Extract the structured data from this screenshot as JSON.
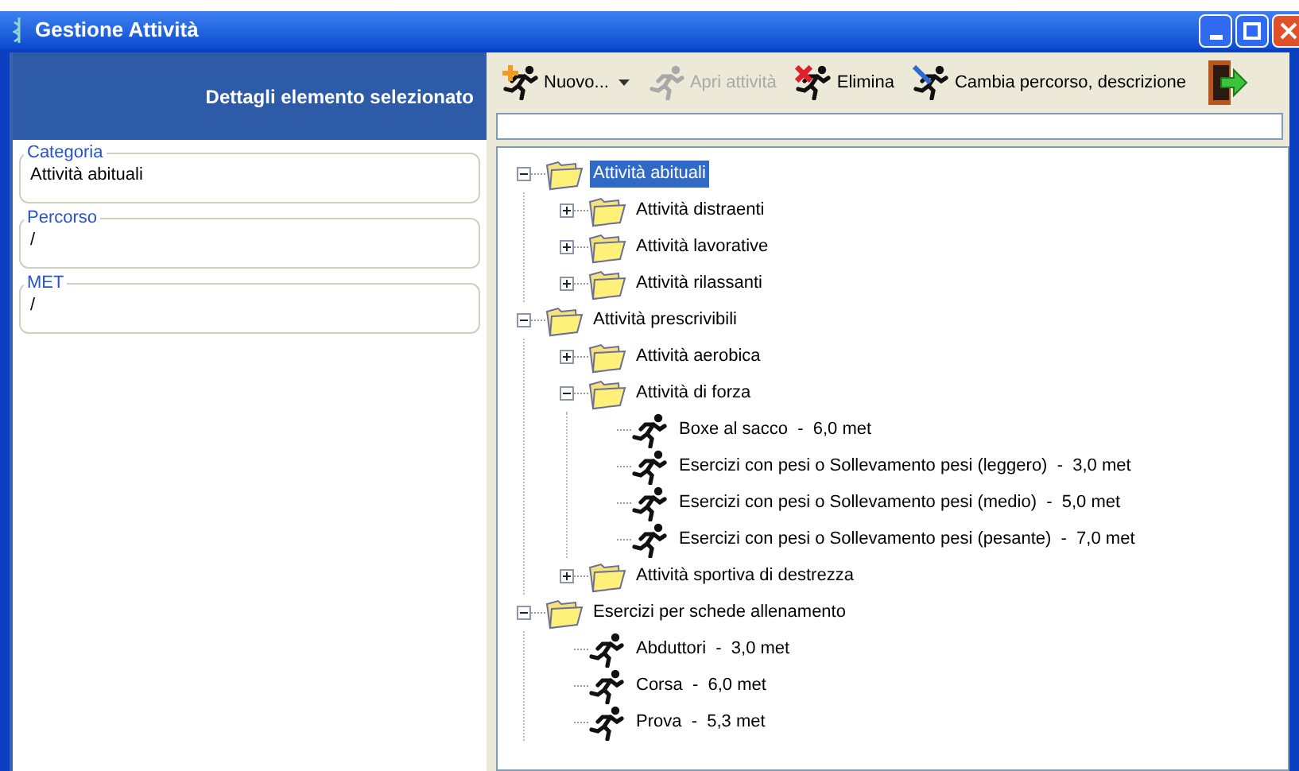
{
  "window": {
    "title": "Gestione Attività"
  },
  "details": {
    "header": "Dettagli elemento selezionato",
    "fields": [
      {
        "label": "Categoria",
        "value": "Attività abituali"
      },
      {
        "label": "Percorso",
        "value": "/"
      },
      {
        "label": "MET",
        "value": "/"
      }
    ]
  },
  "toolbar": [
    {
      "kind": "new",
      "label": "Nuovo...",
      "disabled": false,
      "dropdown": true
    },
    {
      "kind": "open",
      "label": "Apri attività",
      "disabled": true
    },
    {
      "kind": "delete",
      "label": "Elimina",
      "disabled": false
    },
    {
      "kind": "edit",
      "label": "Cambia percorso, descrizione",
      "disabled": false
    },
    {
      "kind": "exit",
      "disabled": false
    }
  ],
  "tree": [
    {
      "kind": "folder",
      "label": "Attività abituali",
      "expanded": true,
      "selected": true,
      "children": [
        {
          "kind": "folder",
          "label": "Attività distraenti",
          "expanded": false,
          "selected": false
        },
        {
          "kind": "folder",
          "label": "Attività lavorative",
          "expanded": false,
          "selected": false
        },
        {
          "kind": "folder",
          "label": "Attività rilassanti",
          "expanded": false,
          "selected": false
        }
      ]
    },
    {
      "kind": "folder",
      "label": "Attività prescrivibili",
      "expanded": true,
      "selected": false,
      "children": [
        {
          "kind": "folder",
          "label": "Attività aerobica",
          "expanded": false,
          "selected": false
        },
        {
          "kind": "folder",
          "label": "Attività di forza",
          "expanded": true,
          "selected": false,
          "children": [
            {
              "kind": "activity",
              "label": "Boxe al sacco  -  6,0 met",
              "selected": false
            },
            {
              "kind": "activity",
              "label": "Esercizi con pesi o Sollevamento pesi (leggero)  -  3,0 met",
              "selected": false
            },
            {
              "kind": "activity",
              "label": "Esercizi con pesi o Sollevamento pesi (medio)  -  5,0 met",
              "selected": false
            },
            {
              "kind": "activity",
              "label": "Esercizi con pesi o Sollevamento pesi (pesante)  -  7,0 met",
              "selected": false
            }
          ]
        },
        {
          "kind": "folder",
          "label": "Attività sportiva di destrezza",
          "expanded": false,
          "selected": false
        }
      ]
    },
    {
      "kind": "folder",
      "label": "Esercizi per schede allenamento",
      "expanded": true,
      "selected": false,
      "children": [
        {
          "kind": "activity",
          "label": "Abduttori  -  3,0 met",
          "selected": false
        },
        {
          "kind": "activity",
          "label": "Corsa  -  6,0 met",
          "selected": false
        },
        {
          "kind": "activity",
          "label": "Prova  -  5,3 met",
          "selected": false
        }
      ]
    }
  ]
}
